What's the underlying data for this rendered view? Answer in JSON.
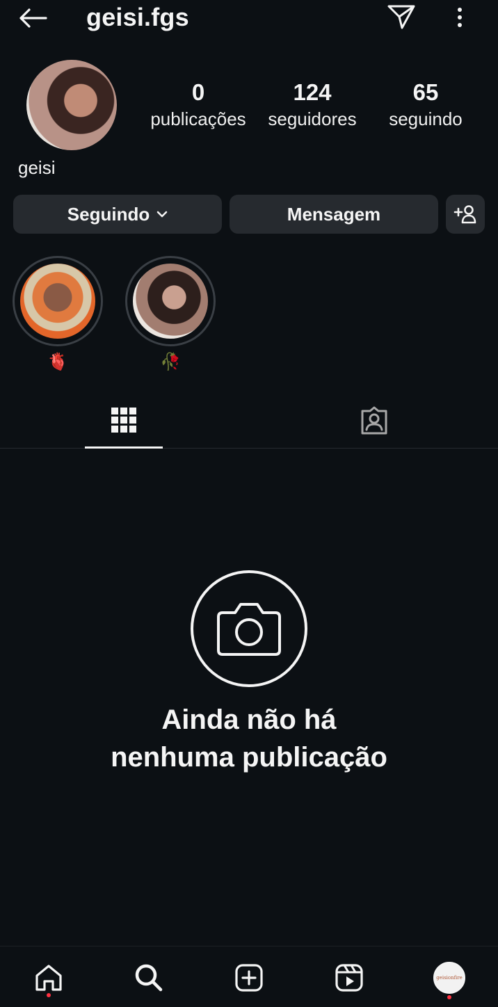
{
  "header": {
    "username": "geisi.fgs",
    "icons": {
      "back": "arrow-left-icon",
      "send": "paper-plane-icon",
      "more": "vertical-ellipsis-icon"
    }
  },
  "profile": {
    "display_name": "geisi",
    "stats": [
      {
        "value": "0",
        "label": "publicações"
      },
      {
        "value": "124",
        "label": "seguidores"
      },
      {
        "value": "65",
        "label": "seguindo"
      }
    ]
  },
  "actions": {
    "following_label": "Seguindo",
    "message_label": "Mensagem",
    "add_icon": "add-person-icon"
  },
  "highlights": [
    {
      "label": "🫀"
    },
    {
      "label": "🥀"
    }
  ],
  "tabs": [
    {
      "name": "grid",
      "icon": "grid-icon",
      "active": true
    },
    {
      "name": "tagged",
      "icon": "tagged-person-icon",
      "active": false
    }
  ],
  "empty_state": {
    "line1": "Ainda não há",
    "line2": "nenhuma publicação",
    "icon": "camera-icon"
  },
  "bottom_nav": {
    "items": [
      "home",
      "search",
      "create",
      "reels",
      "profile"
    ],
    "profile_thumb_text": "geisionfire",
    "notification_color": "#ff3040"
  },
  "colors": {
    "background": "#0c1014",
    "button": "#262a2f",
    "text": "#f5f5f5"
  }
}
